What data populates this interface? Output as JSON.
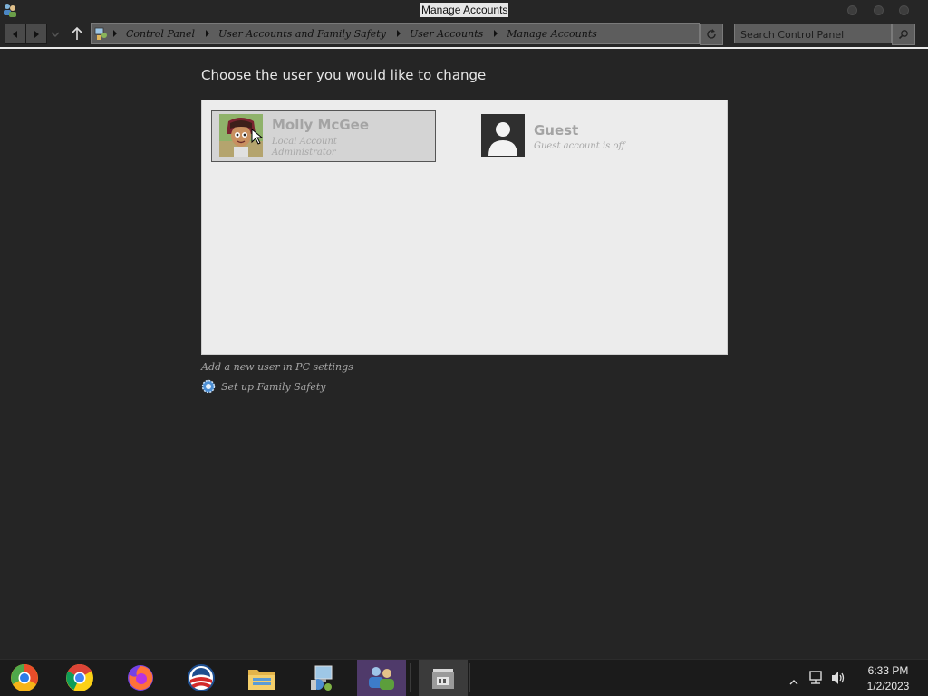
{
  "window": {
    "title": "Manage Accounts"
  },
  "nav": {
    "breadcrumbs": [
      "Control Panel",
      "User Accounts and Family Safety",
      "User Accounts",
      "Manage Accounts"
    ],
    "search_placeholder": "Search Control Panel"
  },
  "main": {
    "heading": "Choose the user you would like to change",
    "accounts": [
      {
        "name": "Molly McGee",
        "line1": "Local Account",
        "line2": "Administrator",
        "selected": true
      },
      {
        "name": "Guest",
        "line1": "Guest account is off",
        "selected": false
      }
    ],
    "links": {
      "add_user": "Add a new user in PC settings",
      "family_safety": "Set up Family Safety"
    }
  },
  "taskbar": {
    "apps": [
      "chrome-canary-icon",
      "chrome-icon",
      "firefox-icon",
      "obama-logo-icon",
      "file-explorer-icon",
      "control-panel-icon",
      "user-accounts-icon",
      "store-icon"
    ],
    "time": "6:33 PM",
    "date": "1/2/2023"
  },
  "colors": {
    "background": "#252525",
    "panel": "#ececec",
    "taskbar": "#1b1b1b",
    "active_app": "#4f3a6a"
  }
}
